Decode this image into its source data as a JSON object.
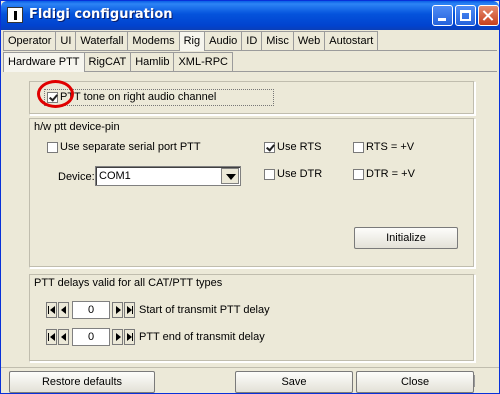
{
  "window": {
    "title": "Fldigi configuration"
  },
  "tabs_main": [
    "Operator",
    "UI",
    "Waterfall",
    "Modems",
    "Rig",
    "Audio",
    "ID",
    "Misc",
    "Web",
    "Autostart"
  ],
  "tabs_sub": [
    "Hardware PTT",
    "RigCAT",
    "Hamlib",
    "XML-RPC"
  ],
  "ptt_tone": {
    "label": "PTT tone on right audio channel",
    "checked": true
  },
  "hw_ptt": {
    "title": "h/w ptt device-pin",
    "separate_port": "Use separate serial port PTT",
    "use_rts": "Use RTS",
    "rts_v": "RTS = +V",
    "use_dtr": "Use DTR",
    "dtr_v": "DTR = +V",
    "device_label": "Device:",
    "device_value": "COM1",
    "initialize": "Initialize"
  },
  "delays": {
    "title": "PTT delays valid for all CAT/PTT types",
    "start_value": "0",
    "start_label": "Start of transmit PTT delay",
    "end_value": "0",
    "end_label": "PTT end of transmit delay"
  },
  "footer": {
    "restore": "Restore defaults",
    "save": "Save",
    "close": "Close"
  }
}
